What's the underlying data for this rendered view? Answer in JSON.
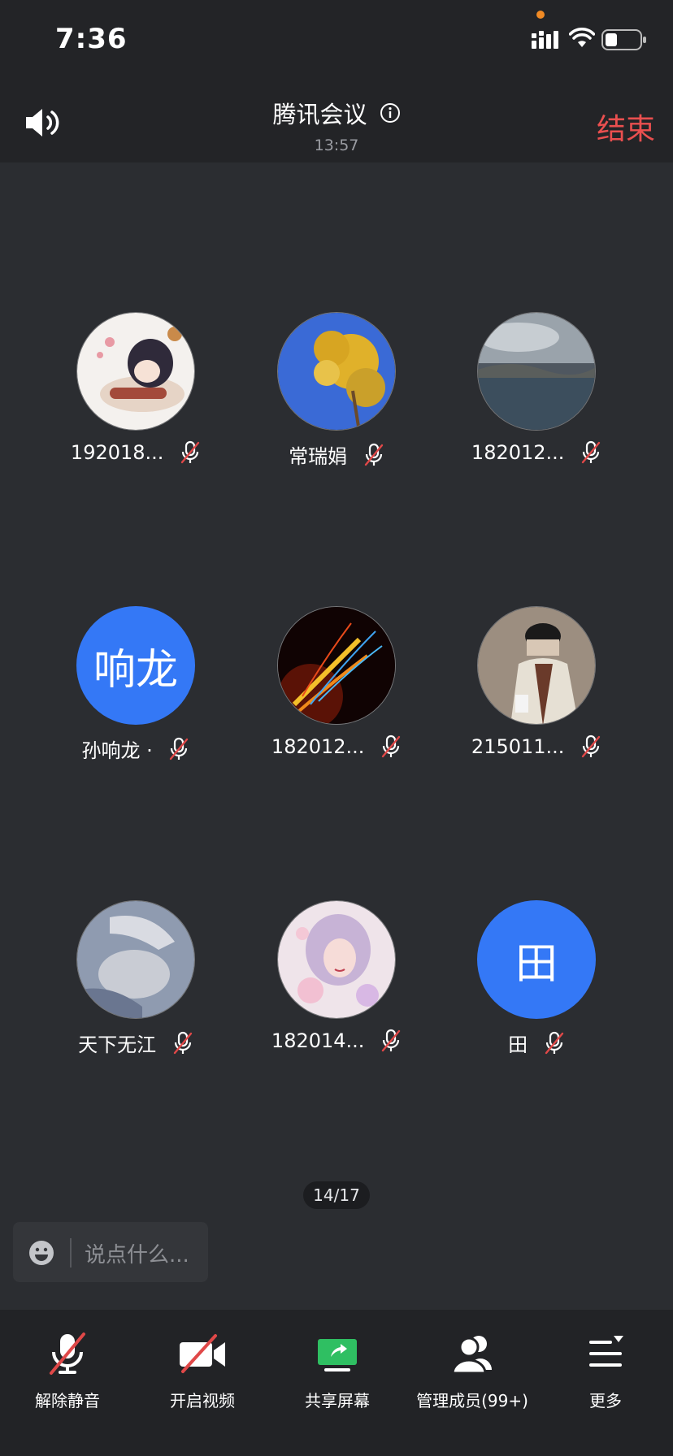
{
  "status_bar": {
    "time": "7:36"
  },
  "header": {
    "title": "腾讯会议",
    "duration": "13:57",
    "end_label": "结束"
  },
  "participants": [
    {
      "name": "192018...",
      "avatar": "image-anime-figure"
    },
    {
      "name": "常瑞娟",
      "avatar": "image-ginkgo-tree"
    },
    {
      "name": "182012...",
      "avatar": "image-lake-landscape"
    },
    {
      "name": "孙响龙 ·",
      "avatar_text": "响龙"
    },
    {
      "name": "182012...",
      "avatar": "image-light-streaks"
    },
    {
      "name": "215011...",
      "avatar": "image-person-coat"
    },
    {
      "name": "天下无江",
      "avatar": "image-person-portrait"
    },
    {
      "name": "182014...",
      "avatar": "image-floral-girl"
    },
    {
      "name": "田",
      "avatar_text": "田"
    }
  ],
  "pagination": {
    "indicator": "14/17"
  },
  "chat": {
    "placeholder": "说点什么..."
  },
  "toolbar": {
    "unmute": "解除静音",
    "start_video": "开启视频",
    "share_screen": "共享屏幕",
    "manage_members": "管理成员(99+)",
    "more": "更多"
  },
  "colors": {
    "accent_blue": "#3478f6",
    "end_red": "#ea4f4f",
    "share_green": "#2fbf62"
  }
}
